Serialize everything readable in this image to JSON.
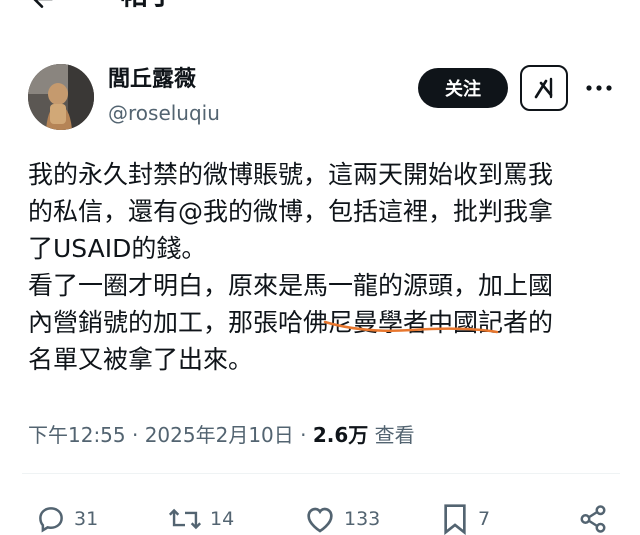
{
  "header": {
    "title": "帖子"
  },
  "author": {
    "display_name": "閭丘露薇",
    "handle": "@roseluqiu"
  },
  "actions_top": {
    "follow_label": "关注"
  },
  "post": {
    "text": "我的永久封禁的微博賬號，這兩天開始收到罵我\n的私信，還有@我的微博，包括這裡，批判我拿\n了USAID的錢。\n看了一圈才明白，原來是馬一龍的源頭，加上國\n內營銷號的加工，那張哈佛尼曼學者中國記者的\n名單又被拿了出來。",
    "time": "下午12:55 · 2025年2月10日 · ",
    "views_count": "2.6万",
    "views_label": " 查看"
  },
  "engagement": {
    "replies": "31",
    "reposts": "14",
    "likes": "133",
    "bookmarks": "7"
  },
  "colors": {
    "text": "#0f1419",
    "secondary": "#536471",
    "highlight_underline": "#e8772e"
  }
}
